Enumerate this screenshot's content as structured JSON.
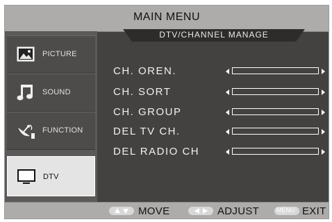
{
  "header": {
    "title": "MAIN  MENU",
    "subtitle": "DTV/CHANNEL MANAGE"
  },
  "sidebar": {
    "items": [
      {
        "label": "PICTURE",
        "icon": "picture-icon",
        "active": false
      },
      {
        "label": "SOUND",
        "icon": "music-note-icon",
        "active": false
      },
      {
        "label": "FUNCTION",
        "icon": "satellite-dish-icon",
        "active": false
      },
      {
        "label": "DTV",
        "icon": "tv-icon",
        "active": true
      }
    ]
  },
  "main": {
    "rows": [
      {
        "label": "CH.  OREN."
      },
      {
        "label": "CH.  SORT"
      },
      {
        "label": "CH.  GROUP"
      },
      {
        "label": "DEL  TV CH."
      },
      {
        "label": "DEL  RADIO CH"
      }
    ]
  },
  "footer": {
    "move_label": "MOVE",
    "adjust_label": "ADJUST",
    "menu_key": "MENU",
    "exit_label": "EXIT"
  },
  "colors": {
    "background": "#444240",
    "header_bar": "#aeacaa",
    "active_item": "#e4e4e4",
    "key_icon": "#d8d8d8"
  }
}
